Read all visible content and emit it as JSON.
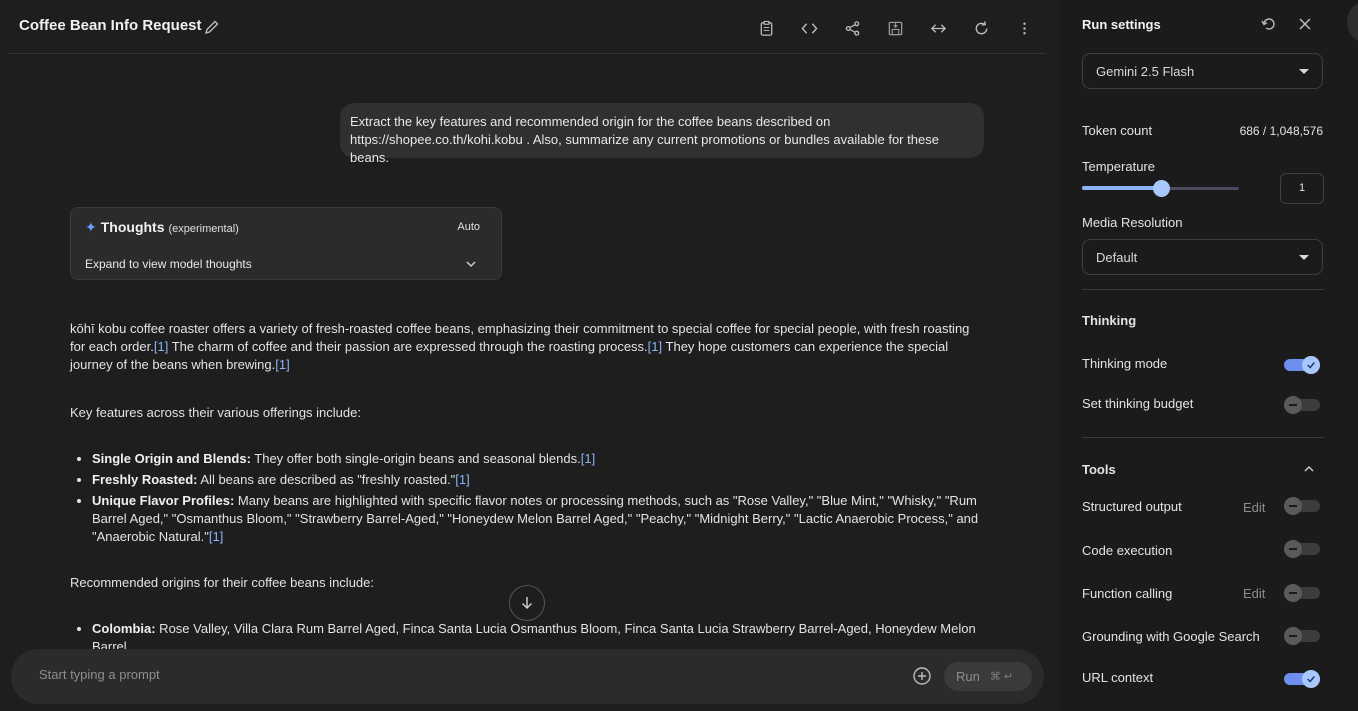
{
  "header": {
    "title": "Coffee Bean Info Request"
  },
  "user_message": "Extract the key features and recommended origin for the coffee beans described on https://shopee.co.th/kohi.kobu . Also, summarize any current promotions or bundles available for these beans.",
  "thoughts": {
    "title": "Thoughts",
    "subtitle": "(experimental)",
    "mode": "Auto",
    "expand_label": "Expand to view model thoughts"
  },
  "response": {
    "intro_a": "kōhī kobu coffee roaster offers a variety of fresh-roasted coffee beans, emphasizing their commitment to special coffee for special people, with fresh roasting for each order.",
    "intro_b": " The charm of coffee and their passion are expressed through the roasting process.",
    "intro_c": " They hope customers can experience the special journey of the beans when brewing.",
    "cite": "1",
    "features_heading": "Key features across their various offerings include:",
    "features": [
      {
        "label": "Single Origin and Blends:",
        "text": " They offer both single-origin beans and seasonal blends."
      },
      {
        "label": "Freshly Roasted:",
        "text": " All beans are described as \"freshly roasted.\""
      },
      {
        "label": "Unique Flavor Profiles:",
        "text": " Many beans are highlighted with specific flavor notes or processing methods, such as \"Rose Valley,\" \"Blue Mint,\" \"Whisky,\" \"Rum Barrel Aged,\" \"Osmanthus Bloom,\" \"Strawberry Barrel-Aged,\" \"Honeydew Melon Barrel Aged,\" \"Peachy,\" \"Midnight Berry,\" \"Lactic Anaerobic Process,\" and \"Anaerobic Natural.\""
      }
    ],
    "origins_heading": "Recommended origins for their coffee beans include:",
    "origins": [
      {
        "label": "Colombia:",
        "text": " Rose Valley, Villa Clara Rum Barrel Aged, Finca Santa Lucia Osmanthus Bloom, Finca Santa Lucia Strawberry Barrel-Aged, Honeydew Melon Barrel"
      }
    ]
  },
  "prompt": {
    "placeholder": "Start typing a prompt",
    "run_label": "Run",
    "run_shortcut": "⌘ ↵"
  },
  "run_settings": {
    "title": "Run settings",
    "model": "Gemini 2.5 Flash",
    "token_count_label": "Token count",
    "token_count_value": "686 / 1,048,576",
    "temperature_label": "Temperature",
    "temperature_value": "1",
    "temperature_fraction": 0.5,
    "media_resolution_label": "Media Resolution",
    "media_resolution_value": "Default",
    "thinking_title": "Thinking",
    "thinking_mode_label": "Thinking mode",
    "thinking_mode_on": true,
    "thinking_budget_label": "Set thinking budget",
    "thinking_budget_on": false,
    "tools_title": "Tools",
    "edit_label": "Edit",
    "tools": [
      {
        "label": "Structured output",
        "on": false,
        "editable": true
      },
      {
        "label": "Code execution",
        "on": false,
        "editable": false
      },
      {
        "label": "Function calling",
        "on": false,
        "editable": true
      },
      {
        "label": "Grounding with Google Search",
        "on": false,
        "editable": false
      },
      {
        "label": "URL context",
        "on": true,
        "editable": false
      }
    ]
  },
  "colors": {
    "accent": "#8ab4f8",
    "toggle_on": "#a8c7fa"
  }
}
